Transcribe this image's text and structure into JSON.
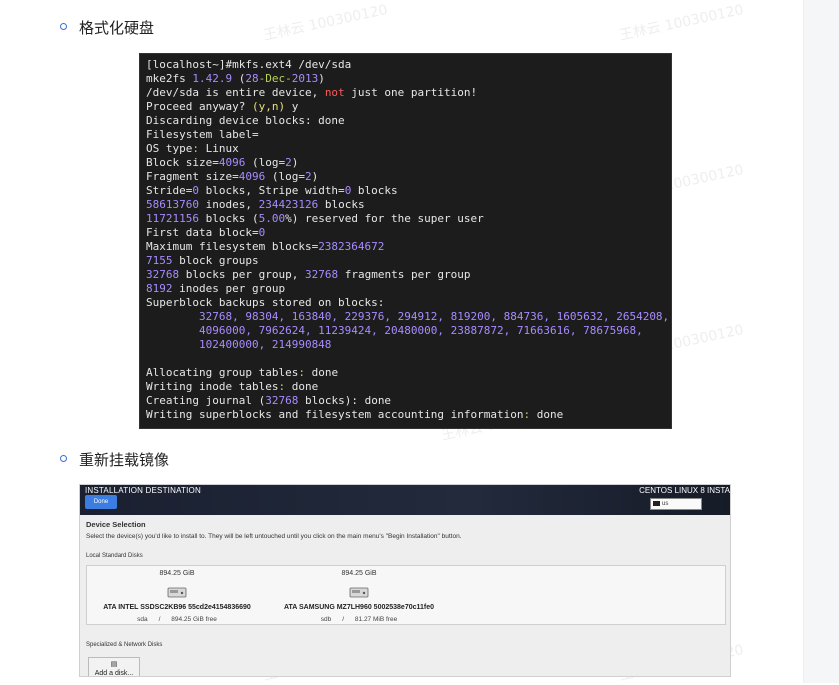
{
  "sections": [
    {
      "title": "格式化硬盘"
    },
    {
      "title": "重新挂载镜像"
    }
  ],
  "watermark": "王林云 100300120",
  "terminal": {
    "lines": [
      [
        {
          "t": "[localhost~]#mkfs.ext4 /dev/sda",
          "c": ""
        }
      ],
      [
        {
          "t": "mke2fs ",
          "c": ""
        },
        {
          "t": "1.42.9",
          "c": "num"
        },
        {
          "t": " (",
          "c": ""
        },
        {
          "t": "28",
          "c": "num"
        },
        {
          "t": "-Dec-",
          "c": "green"
        },
        {
          "t": "2013",
          "c": "num"
        },
        {
          "t": ")",
          "c": ""
        }
      ],
      [
        {
          "t": "/dev/sda is entire device, ",
          "c": ""
        },
        {
          "t": "not",
          "c": "red"
        },
        {
          "t": " just one partition!",
          "c": ""
        }
      ],
      [
        {
          "t": "Proceed anyway? ",
          "c": ""
        },
        {
          "t": "(y,n)",
          "c": "yel"
        },
        {
          "t": " y",
          "c": ""
        }
      ],
      [
        {
          "t": "Discarding device blocks: done",
          "c": ""
        }
      ],
      [
        {
          "t": "Filesystem label=",
          "c": ""
        }
      ],
      [
        {
          "t": "OS type",
          "c": ""
        },
        {
          "t": ":",
          "c": "green"
        },
        {
          "t": " Linux",
          "c": ""
        }
      ],
      [
        {
          "t": "Block size=",
          "c": ""
        },
        {
          "t": "4096",
          "c": "num"
        },
        {
          "t": " (log=",
          "c": ""
        },
        {
          "t": "2",
          "c": "num"
        },
        {
          "t": ")",
          "c": ""
        }
      ],
      [
        {
          "t": "Fragment size=",
          "c": ""
        },
        {
          "t": "4096",
          "c": "num"
        },
        {
          "t": " (log=",
          "c": ""
        },
        {
          "t": "2",
          "c": "num"
        },
        {
          "t": ")",
          "c": ""
        }
      ],
      [
        {
          "t": "Stride=",
          "c": ""
        },
        {
          "t": "0",
          "c": "num"
        },
        {
          "t": " blocks, Stripe width=",
          "c": ""
        },
        {
          "t": "0",
          "c": "num"
        },
        {
          "t": " blocks",
          "c": ""
        }
      ],
      [
        {
          "t": "58613760",
          "c": "num"
        },
        {
          "t": " inodes, ",
          "c": ""
        },
        {
          "t": "234423126",
          "c": "num"
        },
        {
          "t": " blocks",
          "c": ""
        }
      ],
      [
        {
          "t": "11721156",
          "c": "num"
        },
        {
          "t": " blocks (",
          "c": ""
        },
        {
          "t": "5.00",
          "c": "num"
        },
        {
          "t": "%) reserved for the super user",
          "c": ""
        }
      ],
      [
        {
          "t": "First data block=",
          "c": ""
        },
        {
          "t": "0",
          "c": "num"
        }
      ],
      [
        {
          "t": "Maximum filesystem blocks=",
          "c": ""
        },
        {
          "t": "2382364672",
          "c": "num"
        }
      ],
      [
        {
          "t": "7155",
          "c": "num"
        },
        {
          "t": " block groups",
          "c": ""
        }
      ],
      [
        {
          "t": "32768",
          "c": "num"
        },
        {
          "t": " blocks per group, ",
          "c": ""
        },
        {
          "t": "32768",
          "c": "num"
        },
        {
          "t": " fragments per group",
          "c": ""
        }
      ],
      [
        {
          "t": "8192",
          "c": "num"
        },
        {
          "t": " inodes per group",
          "c": ""
        }
      ],
      [
        {
          "t": "Superblock backups stored on blocks:",
          "c": ""
        }
      ],
      [
        {
          "t": "        32768, 98304, 163840, 229376, 294912, 819200, 884736, 1605632, 2654208,",
          "c": "num"
        }
      ],
      [
        {
          "t": "        4096000, 7962624, 11239424, 20480000, 23887872, 71663616, 78675968,",
          "c": "num"
        }
      ],
      [
        {
          "t": "        102400000, 214990848",
          "c": "num"
        }
      ],
      [
        {
          "t": "",
          "c": ""
        }
      ],
      [
        {
          "t": "Allocating group tables",
          "c": ""
        },
        {
          "t": ":",
          "c": "green"
        },
        {
          "t": " done",
          "c": ""
        }
      ],
      [
        {
          "t": "Writing inode tables",
          "c": ""
        },
        {
          "t": ":",
          "c": "green"
        },
        {
          "t": " done",
          "c": ""
        }
      ],
      [
        {
          "t": "Creating journal (",
          "c": ""
        },
        {
          "t": "32768",
          "c": "num"
        },
        {
          "t": " blocks): done",
          "c": ""
        }
      ],
      [
        {
          "t": "Writing superblocks and filesystem accounting information",
          "c": ""
        },
        {
          "t": ":",
          "c": "green"
        },
        {
          "t": " done",
          "c": ""
        }
      ]
    ],
    "colors": {
      "num": "#a88bff",
      "green": "#b7d35a",
      "red": "#ff5a5a",
      "yel": "#e8e077"
    }
  },
  "installer": {
    "title": "INSTALLATION DESTINATION",
    "done_label": "Done",
    "right_title": "CENTOS LINUX 8 INSTA",
    "keyboard": "us",
    "device_selection": "Device Selection",
    "device_hint": "Select the device(s) you'd like to install to.  They will be left untouched until you click on the main menu's \"Begin Installation\" button.",
    "local_disks_label": "Local Standard Disks",
    "disks": [
      {
        "size": "894.25 GiB",
        "name": "ATA INTEL SSDSC2KB96 55cd2e4154836690",
        "dev": "sda",
        "sep": "/",
        "free": "894.25 GiB free"
      },
      {
        "size": "894.25 GiB",
        "name": "ATA SAMSUNG MZ7LH960 5002538e70c11fe0",
        "dev": "sdb",
        "sep": "/",
        "free": "81.27 MiB free"
      }
    ],
    "network_disks_label": "Specialized & Network Disks",
    "add_disk_label": "Add a disk..."
  }
}
